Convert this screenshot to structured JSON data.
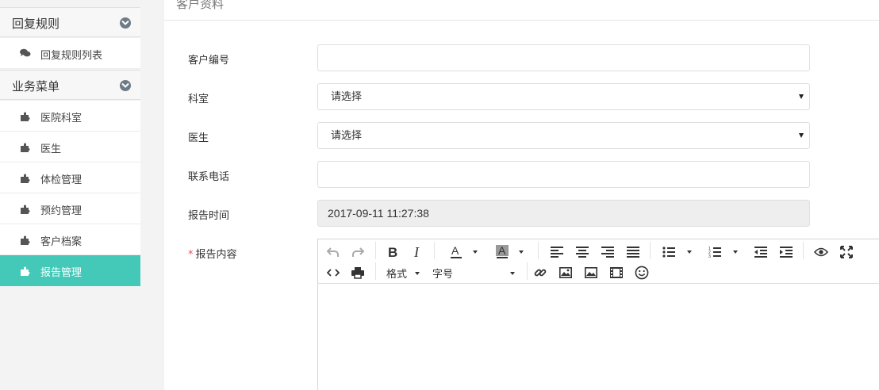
{
  "sidebar": {
    "groups": [
      {
        "label": "回复规则",
        "items": [
          {
            "label": "回复规则列表"
          }
        ]
      },
      {
        "label": "业务菜单",
        "items": [
          {
            "label": "医院科室"
          },
          {
            "label": "医生"
          },
          {
            "label": "体检管理"
          },
          {
            "label": "预约管理"
          },
          {
            "label": "客户档案"
          },
          {
            "label": "报告管理"
          }
        ]
      }
    ],
    "active_item": "报告管理",
    "active_color": "#44c8b8"
  },
  "panel": {
    "title": "客户资料",
    "fields": {
      "customer_no": {
        "label": "客户编号",
        "value": ""
      },
      "department": {
        "label": "科室",
        "value": "请选择"
      },
      "doctor": {
        "label": "医生",
        "value": "请选择"
      },
      "phone": {
        "label": "联系电话",
        "value": ""
      },
      "report_time": {
        "label": "报告时间",
        "value": "2017-09-11 11:27:38"
      },
      "report_content": {
        "label": "报告内容",
        "required_mark": "*"
      }
    }
  },
  "editor": {
    "format_label": "格式",
    "fontsize_label": "字号",
    "icons": [
      "undo-icon",
      "redo-icon",
      "bold-icon",
      "italic-icon",
      "font-color-icon",
      "highlight-icon",
      "align-left-icon",
      "align-center-icon",
      "align-right-icon",
      "align-justify-icon",
      "bullet-list-icon",
      "numbered-list-icon",
      "outdent-icon",
      "indent-icon",
      "preview-icon",
      "fullscreen-icon",
      "source-code-icon",
      "print-icon",
      "link-icon",
      "image-icon",
      "image-gallery-icon",
      "video-icon",
      "emoji-icon"
    ]
  }
}
